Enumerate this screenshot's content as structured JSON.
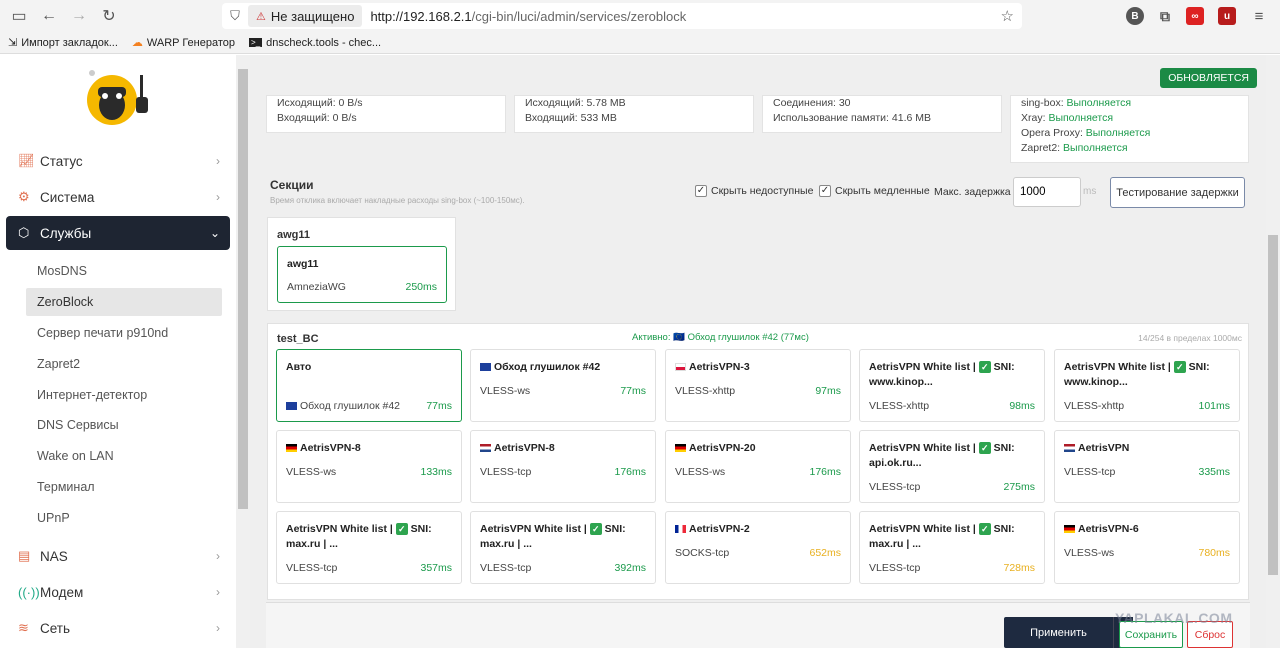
{
  "browser": {
    "insecure_label": "Не защищено",
    "url_host": "http://192.168.2.1",
    "url_path": "/cgi-bin/luci/admin/services/zeroblock",
    "bookmarks": [
      "Импорт закладок...",
      "WARP Генератор",
      "dnscheck.tools - chec..."
    ]
  },
  "sidebar": {
    "menu": [
      {
        "label": "Статус",
        "icon": "chart-icon"
      },
      {
        "label": "Система",
        "icon": "gear-icon"
      },
      {
        "label": "Службы",
        "icon": "cube-icon"
      },
      {
        "label": "NAS",
        "icon": "storage-icon"
      },
      {
        "label": "Модем",
        "icon": "signal-icon"
      },
      {
        "label": "Сеть",
        "icon": "wifi-icon"
      }
    ],
    "submenu": [
      "MosDNS",
      "ZeroBlock",
      "Сервер печати p910nd",
      "Zapret2",
      "Интернет-детектор",
      "DNS Сервисы",
      "Wake on LAN",
      "Терминал",
      "UPnP"
    ]
  },
  "main": {
    "update_badge": "ОБНОВЛЯЕТСЯ",
    "stats": {
      "card1": [
        "Исходящий: 0 B/s",
        "Входящий: 0 B/s"
      ],
      "card2": [
        "Исходящий: 5.78 MB",
        "Входящий: 533 MB"
      ],
      "card3": [
        "Соединения: 30",
        "Использование памяти: 41.6 MB"
      ],
      "services": [
        {
          "name": "sing-box:",
          "status": "Выполняется"
        },
        {
          "name": "Xray:",
          "status": "Выполняется"
        },
        {
          "name": "Opera Proxy:",
          "status": "Выполняется"
        },
        {
          "name": "Zapret2:",
          "status": "Выполняется"
        }
      ]
    },
    "sections": {
      "title": "Секции",
      "desc": "Время отклика включает накладные расходы sing-box (~100-150мс).",
      "hide_unavailable": "Скрыть недоступные",
      "hide_slow": "Скрыть медленные",
      "max_delay_label": "Макс. задержка",
      "max_delay_value": "1000",
      "ms_unit": "ms",
      "test_button": "Тестирование задержки"
    },
    "group1": {
      "title": "awg11",
      "cards": [
        {
          "title": "awg11",
          "proto": "AmneziaWG",
          "latency": "250ms"
        }
      ]
    },
    "group2": {
      "title": "test_BC",
      "active": "Активно: 🇪🇺 Обход глушилок #42 (77мс)",
      "count": "14/254 в пределах 1000мс",
      "cards": [
        {
          "title": "Авто",
          "proto": "Обход глушилок #42",
          "latency": "77ms"
        },
        {
          "title": "Обход глушилок #42",
          "proto": "VLESS-ws",
          "latency": "77ms"
        },
        {
          "title": "AetrisVPN-3",
          "proto": "VLESS-xhttp",
          "latency": "97ms"
        },
        {
          "title_a": "AetrisVPN White list |",
          "title_b": "SNI:",
          "title_c": "www.kinop...",
          "proto": "VLESS-xhttp",
          "latency": "98ms"
        },
        {
          "title_a": "AetrisVPN White list |",
          "title_b": "SNI:",
          "title_c": "www.kinop...",
          "proto": "VLESS-xhttp",
          "latency": "101ms"
        },
        {
          "title": "AetrisVPN-8",
          "proto": "VLESS-ws",
          "latency": "133ms"
        },
        {
          "title": "AetrisVPN-8",
          "proto": "VLESS-tcp",
          "latency": "176ms"
        },
        {
          "title": "AetrisVPN-20",
          "proto": "VLESS-ws",
          "latency": "176ms"
        },
        {
          "title_a": "AetrisVPN White list |",
          "title_b": "SNI:",
          "title_c": "api.ok.ru...",
          "proto": "VLESS-tcp",
          "latency": "275ms"
        },
        {
          "title": "AetrisVPN",
          "proto": "VLESS-tcp",
          "latency": "335ms"
        },
        {
          "title_a": "AetrisVPN White list |",
          "title_b": "SNI:",
          "title_c": "max.ru | ...",
          "proto": "VLESS-tcp",
          "latency": "357ms"
        },
        {
          "title_a": "AetrisVPN White list |",
          "title_b": "SNI:",
          "title_c": "max.ru | ...",
          "proto": "VLESS-tcp",
          "latency": "392ms"
        },
        {
          "title": "AetrisVPN-2",
          "proto": "SOCKS-tcp",
          "latency": "652ms"
        },
        {
          "title_a": "AetrisVPN White list |",
          "title_b": "SNI:",
          "title_c": "max.ru | ...",
          "proto": "VLESS-tcp",
          "latency": "728ms"
        },
        {
          "title": "AetrisVPN-6",
          "proto": "VLESS-ws",
          "latency": "780ms"
        }
      ]
    },
    "footer": {
      "apply": "Применить",
      "save": "Сохранить",
      "reset": "Сброс"
    },
    "watermark": "YAPLAKAL.COM"
  }
}
